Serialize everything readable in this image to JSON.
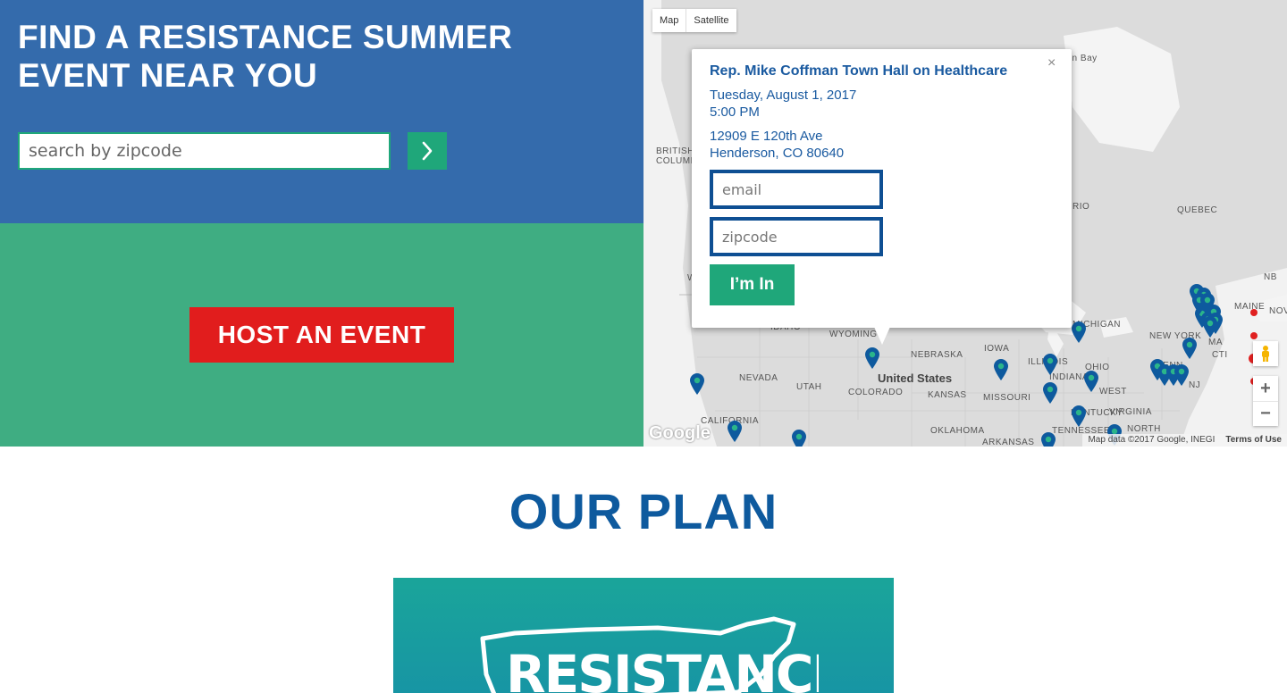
{
  "hero": {
    "title": "FIND A RESISTANCE SUMMER EVENT NEAR YOU",
    "search_placeholder": "search by zipcode",
    "host_label": "HOST AN EVENT"
  },
  "map": {
    "type_controls": [
      "Map",
      "Satellite"
    ],
    "labels": {
      "british_columbia": "BRITISH COLUMB",
      "hudson_bay": "son Bay",
      "ontario": "RIO",
      "quebec": "QUEBEC",
      "nb": "NB",
      "maine": "MAINE",
      "nov": "NOV",
      "michigan": "MICHIGAN",
      "new_york": "NEW YORK",
      "idaho": "IDAHO",
      "wyoming": "WYOMING",
      "nebraska": "NEBRASKA",
      "iowa": "IOWA",
      "illinois": "ILLINOIS",
      "ohio": "OHIO",
      "penn": "PENN",
      "indiana": "INDIANA",
      "nevada": "NEVADA",
      "utah": "UTAH",
      "colorado": "COLORADO",
      "kansas": "KANSAS",
      "missouri": "MISSOURI",
      "west_virginia": "WEST",
      "virginia": "VIRGINIA",
      "kentucky": "KENTUCKY",
      "nj": "NJ",
      "ma": "MA",
      "ct": "CTI",
      "california": "CALIFORNIA",
      "oklahoma": "OKLAHOMA",
      "tennessee": "TENNESSEE",
      "arkansas": "ARKANSAS",
      "north": "NORTH",
      "united_states": "United States",
      "wa": "W"
    },
    "google_logo": "Google",
    "attribution": "Map data ©2017 Google, INEGI",
    "terms": "Terms of Use",
    "zoom_in": "+",
    "zoom_out": "−",
    "accent_pin": "#0e5a9e",
    "accent_red": "#e02020"
  },
  "info_window": {
    "title": "Rep. Mike Coffman Town Hall on Healthcare",
    "date": "Tuesday, August 1, 2017",
    "time": "5:00 PM",
    "address_line1": "12909 E 120th Ave",
    "address_line2": "Henderson, CO 80640",
    "email_placeholder": "email",
    "zip_placeholder": "zipcode",
    "submit_label": "I’m In",
    "close": "×"
  },
  "plan": {
    "title": "OUR PLAN",
    "image_text": "RESISTANCE"
  },
  "colors": {
    "blue": "#0e5a9e",
    "green": "#1fa77a",
    "red": "#e11d1d"
  }
}
